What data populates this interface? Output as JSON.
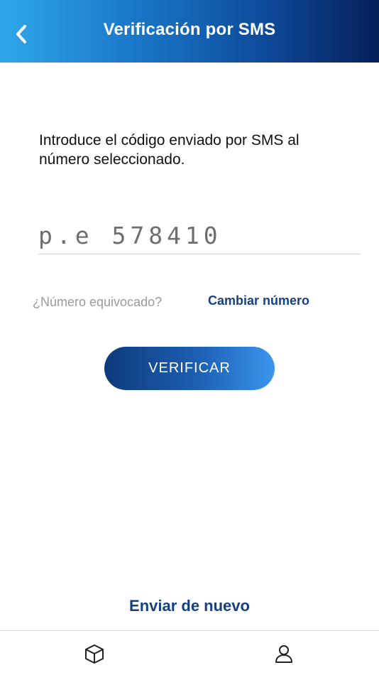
{
  "header": {
    "title": "Verificación por SMS",
    "back_icon": "chevron-left-icon"
  },
  "main": {
    "instruction": "Introduce el código enviado por SMS al número seleccionado.",
    "code_field": {
      "placeholder": "p.e 578410",
      "value": ""
    },
    "wrong_number_text": "¿Número equivocado?",
    "change_number_link": "Cambiar número",
    "verify_button": "VERIFICAR",
    "resend_link": "Enviar de nuevo"
  },
  "bottom_nav": {
    "items": [
      {
        "icon": "box-icon"
      },
      {
        "icon": "user-icon"
      }
    ]
  },
  "colors": {
    "header_gradient_start": "#2fa7ea",
    "header_gradient_end": "#06205a",
    "link_color": "#16407f",
    "button_gradient_start": "#0d3a7a",
    "button_gradient_end": "#3b95ee"
  }
}
